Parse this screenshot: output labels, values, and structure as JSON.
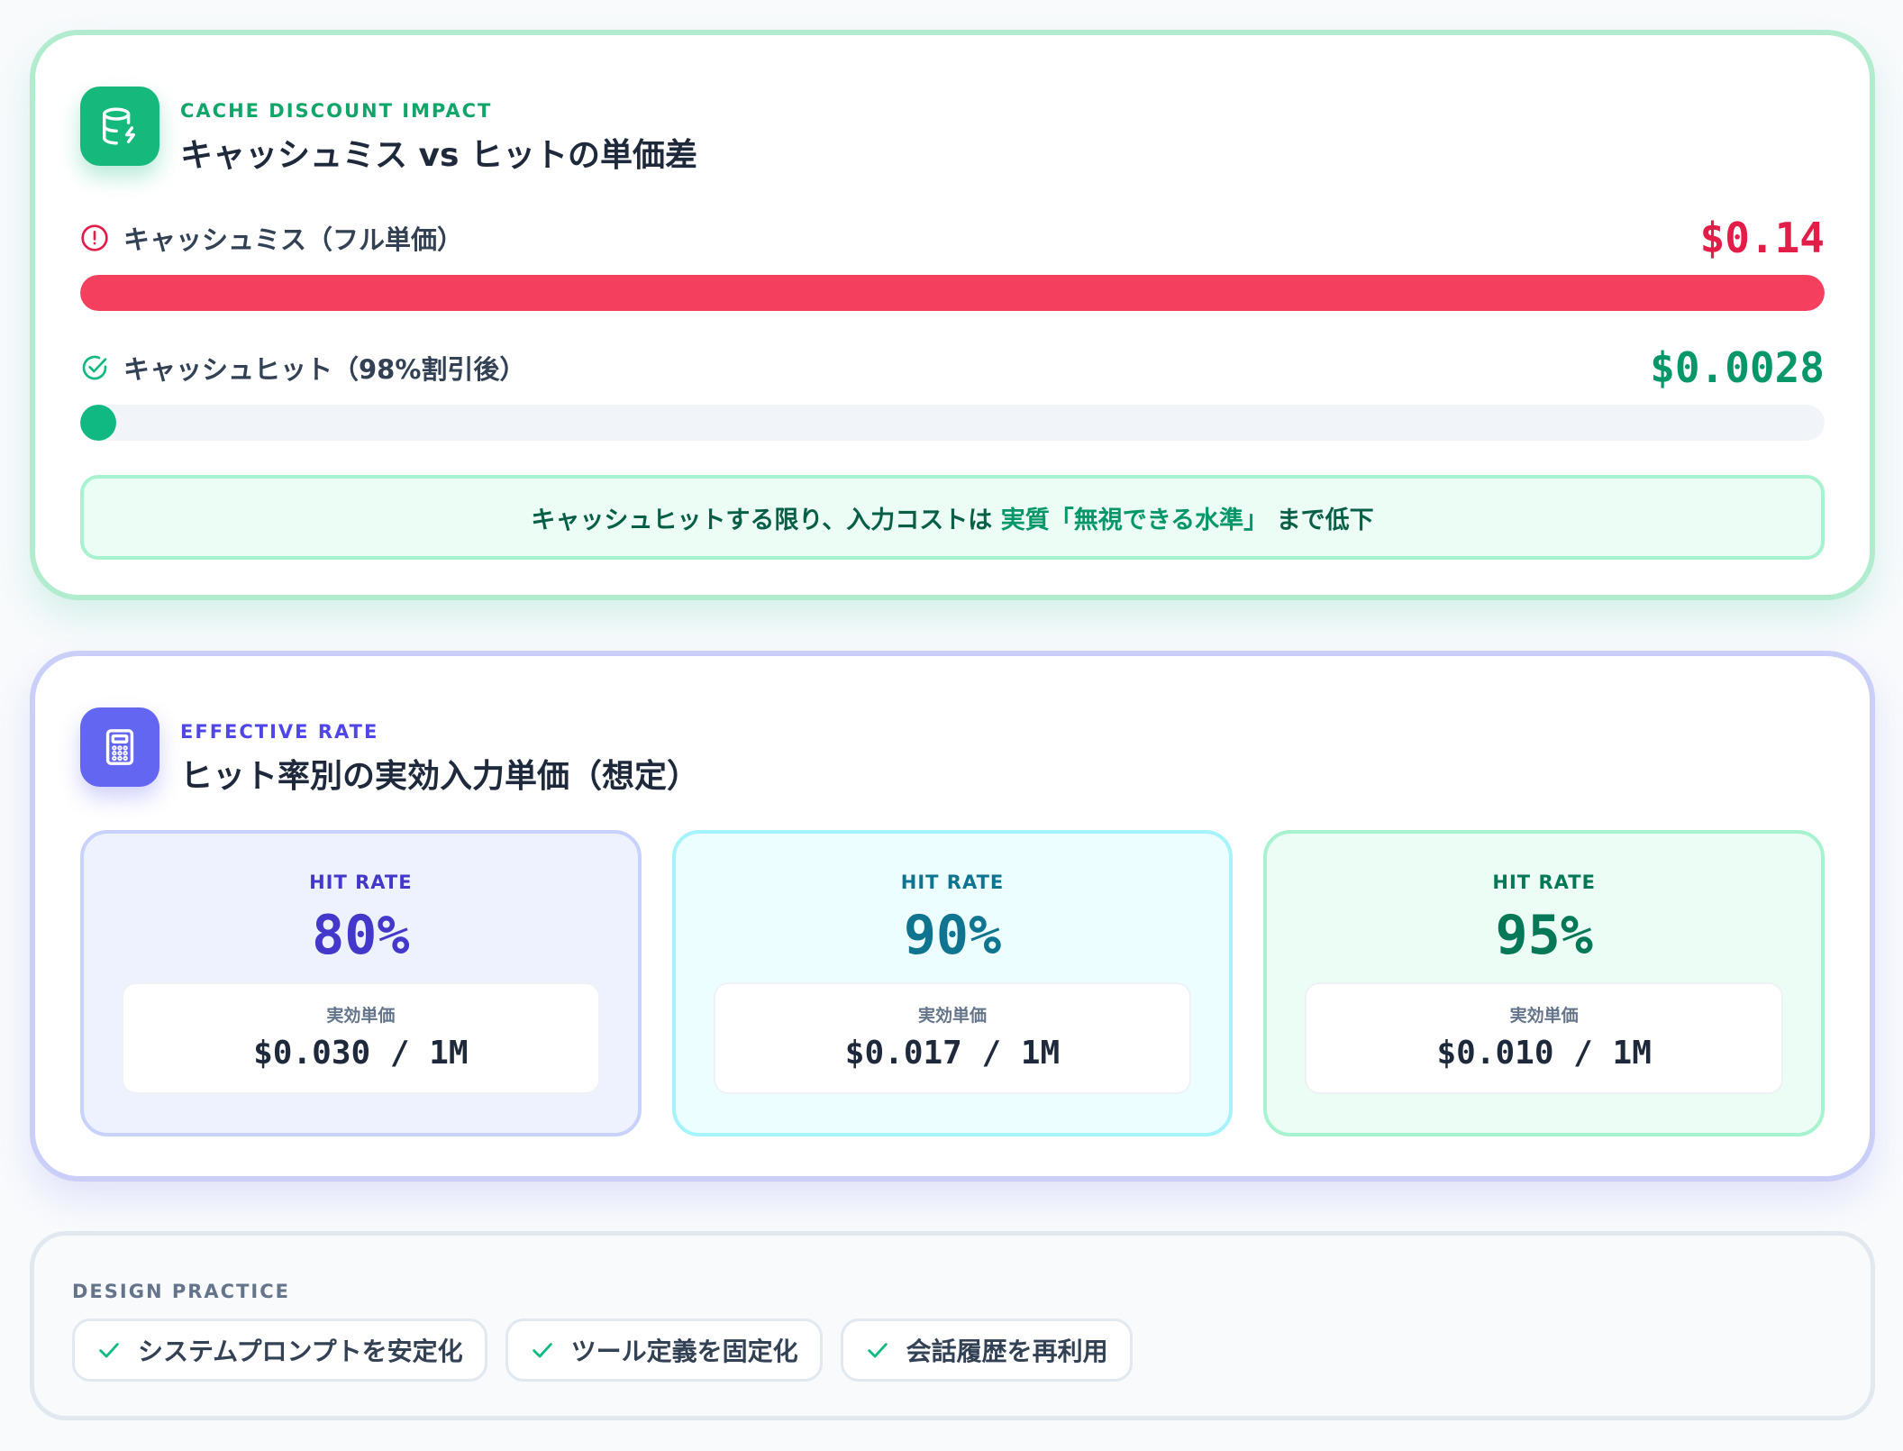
{
  "cache_card": {
    "eyebrow": "CACHE DISCOUNT IMPACT",
    "title": "キャッシュミス vs ヒットの単価差",
    "icon": "database-bolt-icon",
    "miss": {
      "label": "キャッシュミス（フル単価）",
      "value": "$0.14",
      "fill_fraction": 1.0,
      "icon": "alert-circle-icon",
      "color": "#e11d48"
    },
    "hit": {
      "label": "キャッシュヒット（98%割引後）",
      "value": "$0.0028",
      "fill_fraction": 0.02,
      "icon": "check-circle-icon",
      "color": "#059669"
    },
    "callout": {
      "prefix": "キャッシュヒットする限り、入力コストは",
      "highlight": "実質「無視できる水準」",
      "suffix": "まで低下"
    }
  },
  "rate_card": {
    "eyebrow": "EFFECTIVE RATE",
    "title": "ヒット率別の実効入力単価（想定）",
    "icon": "calculator-icon",
    "tiles": [
      {
        "label": "HIT RATE",
        "rate": "80%",
        "inner_label": "実効単価",
        "price": "$0.030 / 1M",
        "accent": "#4338ca"
      },
      {
        "label": "HIT RATE",
        "rate": "90%",
        "inner_label": "実効単価",
        "price": "$0.017 / 1M",
        "accent": "#0e7490"
      },
      {
        "label": "HIT RATE",
        "rate": "95%",
        "inner_label": "実効単価",
        "price": "$0.010 / 1M",
        "accent": "#047857"
      }
    ]
  },
  "practice": {
    "label": "DESIGN PRACTICE",
    "items": [
      {
        "label": "システムプロンプトを安定化",
        "icon": "check-icon"
      },
      {
        "label": "ツール定義を固定化",
        "icon": "check-icon"
      },
      {
        "label": "会話履歴を再利用",
        "icon": "check-icon"
      }
    ]
  }
}
